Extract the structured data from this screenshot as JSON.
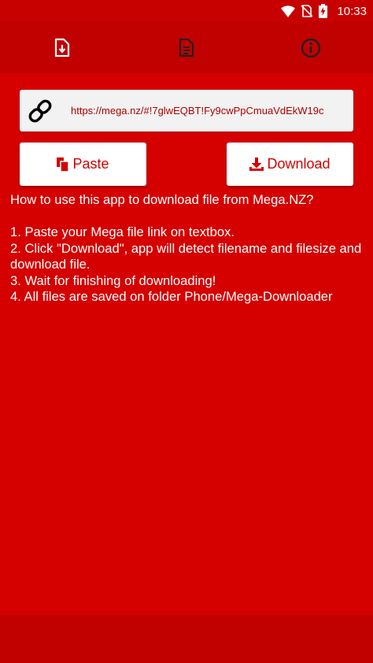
{
  "status_bar": {
    "time": "10:33",
    "icons": [
      "wifi-icon",
      "no-sim-icon",
      "battery-charging-icon"
    ]
  },
  "tabs": [
    {
      "name": "download-file-tab",
      "icon": "file-download-icon"
    },
    {
      "name": "document-tab",
      "icon": "document-icon"
    },
    {
      "name": "info-tab",
      "icon": "info-icon"
    }
  ],
  "url_input": {
    "value": "https://mega.nz/#!7glwEQBT!Fy9cwPpCmuaVdEkW19c",
    "icon": "link-icon"
  },
  "buttons": {
    "paste_label": "Paste",
    "download_label": "Download"
  },
  "instructions": {
    "heading": "How to use this app to download file from Mega.NZ?",
    "steps": [
      "1. Paste your Mega file link on textbox.",
      "2. Click \"Download\", app will detect filename and filesize and download file.",
      "3. Wait for finishing of downloading!",
      "4. All files are saved on folder Phone/Mega-Downloader"
    ]
  },
  "colors": {
    "background": "#d50000",
    "bar": "#c10000",
    "accent_text": "#d50000",
    "text_light": "#ffffff"
  }
}
